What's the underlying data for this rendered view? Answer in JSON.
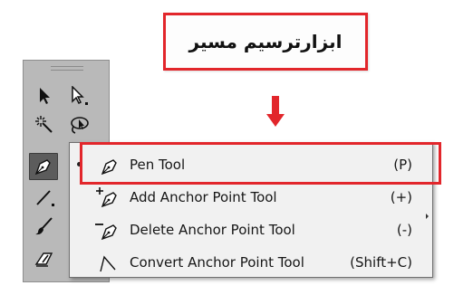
{
  "callout": {
    "text": "ابزارترسیم مسیر"
  },
  "toolbox": {
    "tools": [
      {
        "icon": "selection-arrow-icon"
      },
      {
        "icon": "direct-selection-arrow-icon"
      },
      {
        "icon": "magic-wand-icon"
      },
      {
        "icon": "lasso-icon"
      },
      {
        "icon": "pen-icon"
      },
      {
        "icon": "line-segment-icon"
      },
      {
        "icon": "paintbrush-icon"
      },
      {
        "icon": "pencil-eraser-icon"
      }
    ]
  },
  "flyout": {
    "items": [
      {
        "label": "Pen Tool",
        "shortcut": "(P)",
        "icon": "pen-icon",
        "selected": true
      },
      {
        "label": "Add Anchor Point Tool",
        "shortcut": "(+)",
        "icon": "add-anchor-pen-icon",
        "selected": false
      },
      {
        "label": "Delete Anchor Point Tool",
        "shortcut": "(-)",
        "icon": "delete-anchor-pen-icon",
        "selected": false
      },
      {
        "label": "Convert Anchor Point Tool",
        "shortcut": "(Shift+C)",
        "icon": "convert-anchor-icon",
        "selected": false
      }
    ]
  },
  "colors": {
    "highlight": "#e2262b",
    "arrow": "#e2262b",
    "toolbox_bg": "#b9b9b9",
    "menu_bg": "#f1f1f1"
  }
}
